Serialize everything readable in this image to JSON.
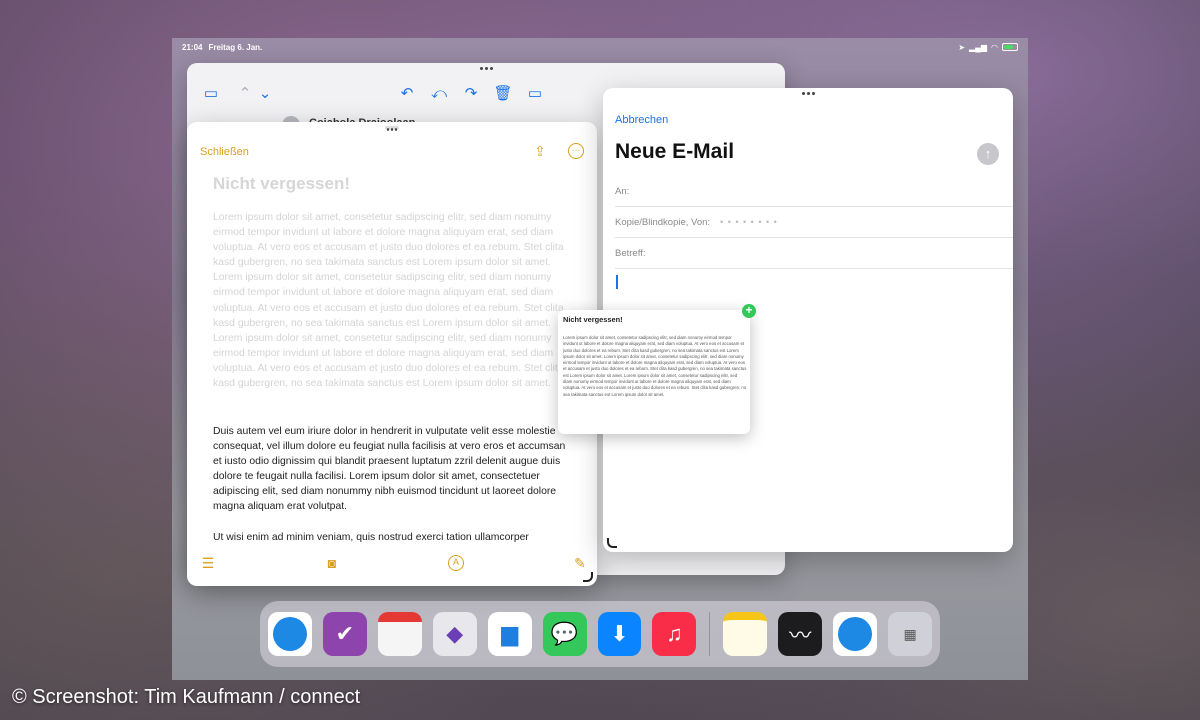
{
  "status_bar": {
    "time": "21:04",
    "date": "Freitag 6. Jan."
  },
  "mail": {
    "sender": "Cojabola Drajoolaan"
  },
  "notes": {
    "close_label": "Schließen",
    "title": "Nicht vergessen!",
    "faded_paragraph": "Lorem ipsum dolor sit amet, consetetur sadipscing elitr, sed diam nonumy eirmod tempor invidunt ut labore et dolore magna aliquyam erat, sed diam voluptua. At vero eos et accusam et justo duo dolores et ea rebum. Stet clita kasd gubergren, no sea takimata sanctus est Lorem ipsum dolor sit amet. Lorem ipsum dolor sit amet, consetetur sadipscing elitr, sed diam nonumy eirmod tempor invidunt ut labore et dolore magna aliquyam erat, sed diam voluptua. At vero eos et accusam et justo duo dolores et ea rebum. Stet clita kasd gubergren, no sea takimata sanctus est Lorem ipsum dolor sit amet. Lorem ipsum dolor sit amet, consetetur sadipscing elitr, sed diam nonumy eirmod tempor invidunt ut labore et dolore magna aliquyam erat, sed diam voluptua. At vero eos et accusam et justo duo dolores et ea rebum. Stet clita kasd gubergren, no sea takimata sanctus est Lorem ipsum dolor sit amet.",
    "paragraph_2": "Duis autem vel eum iriure dolor in hendrerit in vulputate velit esse molestie consequat, vel illum dolore eu feugiat nulla facilisis at vero eros et accumsan et iusto odio dignissim qui blandit praesent luptatum zzril delenit augue duis dolore te feugait nulla facilisi. Lorem ipsum dolor sit amet, consectetuer adipiscing elit, sed diam nonummy nibh euismod tincidunt ut laoreet dolore magna aliquam erat volutpat.",
    "paragraph_3": "Ut wisi enim ad minim veniam, quis nostrud exerci tation ullamcorper"
  },
  "compose": {
    "cancel_label": "Abbrechen",
    "title": "Neue E-Mail",
    "to_label": "An:",
    "cc_label": "Kopie/Blindkopie, Von:",
    "cc_value": "• • • • • • • •",
    "subject_label": "Betreff:"
  },
  "drag_preview": {
    "title": "Nicht vergessen!",
    "text": "Lorem ipsum dolor sit amet, consetetur sadipscing elitr, sed diam nonumy eirmod tempor invidunt ut labore et dolore magna aliquyam erat, sed diam voluptua. At vero eos et accusam et justo duo dolores et ea rebum. Stet clita kasd gubergren, no sea takimata sanctus est Lorem ipsum dolor sit amet. Lorem ipsum dolor sit amet, consetetur sadipscing elitr, sed diam nonumy eirmod tempor invidunt ut labore et dolore magna aliquyam erat, sed diam voluptua. At vero eos et accusam et justo duo dolores et ea rebum. Stet clita kasd gubergren, no sea takimata sanctus est Lorem ipsum dolor sit amet. Lorem ipsum dolor sit amet, consetetur sadipscing elitr, sed diam nonumy eirmod tempor invidunt ut labore et dolore magna aliquyam erat, sed diam voluptua. At vero eos et accusam et justo duo dolores et ea rebum. Stet clita kasd gubergren, no sea takimata sanctus est Lorem ipsum dolor sit amet."
  },
  "dock": {
    "apps": [
      {
        "name": "safari-icon",
        "color": "#1e88e5"
      },
      {
        "name": "omnifocus-icon",
        "color": "#8e44ad"
      },
      {
        "name": "fantastical-icon",
        "color": "#f5f5f5"
      },
      {
        "name": "obsidian-icon",
        "color": "#e8e8ec"
      },
      {
        "name": "files-icon",
        "color": "#1e7fe0"
      },
      {
        "name": "messages-icon",
        "color": "#34c759"
      },
      {
        "name": "transloader-icon",
        "color": "#0a84ff"
      },
      {
        "name": "music-icon",
        "color": "#fa2d48"
      },
      {
        "name": "notes-icon",
        "color": "#fff8d0"
      },
      {
        "name": "stocks-icon",
        "color": "#1c1c1e"
      },
      {
        "name": "safari-recent-icon",
        "color": "#1e88e5"
      },
      {
        "name": "app-library-icon",
        "color": "#d0d0d8"
      }
    ]
  },
  "caption": "© Screenshot: Tim Kaufmann / connect"
}
